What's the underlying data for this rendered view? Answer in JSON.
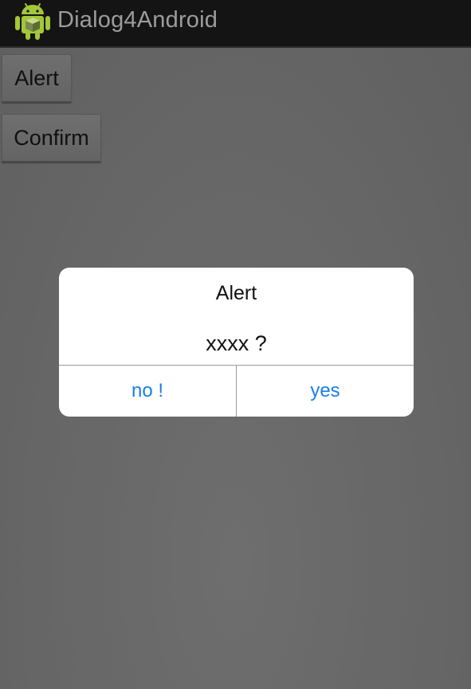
{
  "app": {
    "title": "Dialog4Android",
    "icon": "android-icon"
  },
  "buttons": {
    "alert_label": "Alert",
    "confirm_label": "Confirm"
  },
  "dialog": {
    "title": "Alert",
    "message": "xxxx ?",
    "negative_label": "no !",
    "positive_label": "yes"
  },
  "colors": {
    "action_bar": "#141414",
    "overlay_background": "#6a6a6a",
    "dialog_button_text": "#1a7fe8",
    "android_green": "#a4c639"
  }
}
